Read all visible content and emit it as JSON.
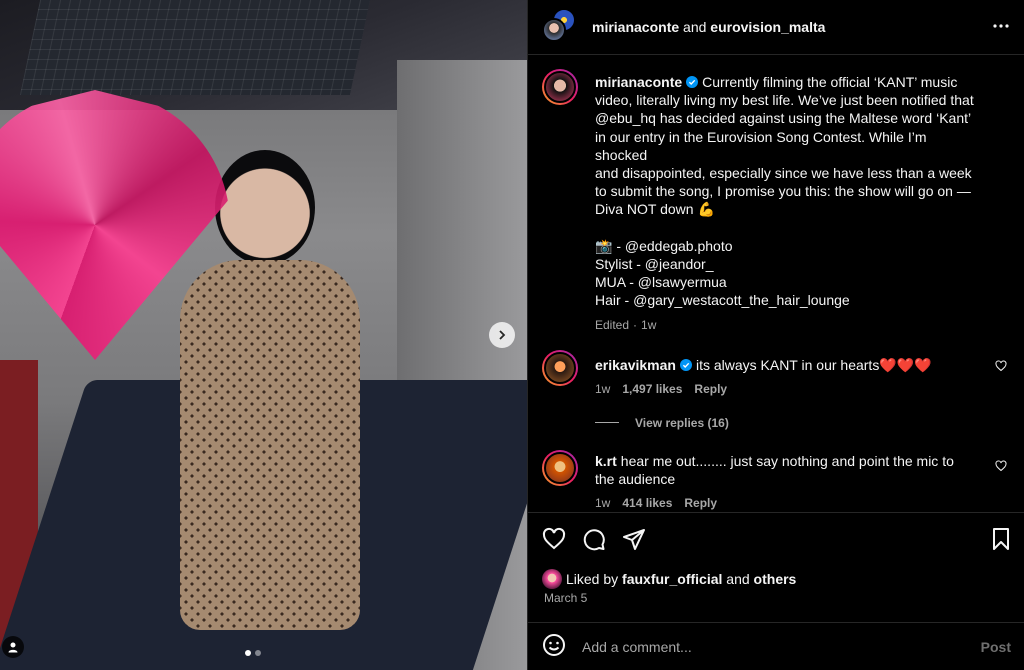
{
  "header": {
    "user1": "mirianaconte",
    "joiner": "and",
    "user2": "eurovision_malta"
  },
  "caption": {
    "username": "mirianaconte",
    "lines": [
      "Currently filming the official ‘KANT’ music",
      "video, literally living my best life. We’ve just been notified that",
      "@ebu_hq has decided against using the Maltese word ‘Kant’",
      "in our entry in the Eurovision Song Contest. While I’m shocked",
      "and disappointed, especially since we have less than a week",
      "to submit the song, I promise you this: the show will go on —",
      "Diva NOT down 💪",
      "",
      "📸 - @eddegab.photo",
      "Stylist - @jeandor_",
      "MUA - @lsawyermua",
      "Hair - @gary_westacott_the_hair_lounge"
    ],
    "edited": "Edited",
    "time": "1w"
  },
  "comments": [
    {
      "username": "erikavikman",
      "text": "its always KANT in our hearts❤️❤️❤️",
      "time": "1w",
      "likes": "1,497 likes",
      "reply": "Reply",
      "view_replies": "View replies (16)"
    },
    {
      "username": "k.rt",
      "text": "hear me out........ just say nothing and point the mic to the audience",
      "time": "1w",
      "likes": "414 likes",
      "reply": "Reply"
    }
  ],
  "likes": {
    "prefix": "Liked by",
    "user": "fauxfur_official",
    "joiner": "and",
    "others": "others"
  },
  "date": "March 5",
  "add_comment": {
    "placeholder": "Add a comment...",
    "post_label": "Post"
  },
  "carousel": {
    "slide_count": 2,
    "active_slide": 1
  },
  "colors": {
    "verified": "#0095f6",
    "background": "#000000",
    "muted_text": "#a8a8a8",
    "divider": "#262626"
  },
  "icons": [
    "more-icon",
    "verified-icon",
    "heart-icon",
    "comment-icon",
    "share-icon",
    "bookmark-icon",
    "emoji-icon",
    "chevron-right-icon",
    "user-tag-icon"
  ]
}
